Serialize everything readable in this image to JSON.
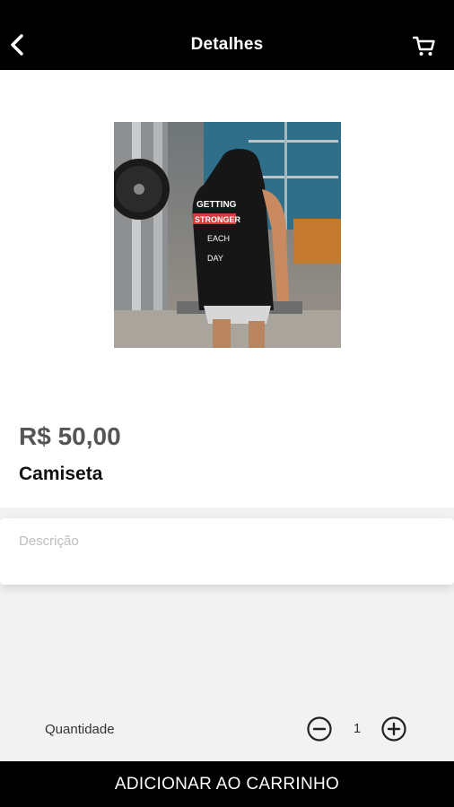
{
  "header": {
    "title": "Detalhes",
    "back_icon": "chevron-left-icon",
    "cart_icon": "cart-icon"
  },
  "product": {
    "price": "R$ 50,00",
    "name": "Camiseta",
    "image_shirt_text": [
      "GETTING",
      "STRONGER",
      "EACH",
      "DAY"
    ]
  },
  "description": {
    "placeholder": "Descrição"
  },
  "quantity": {
    "label": "Quantidade",
    "value": "1",
    "decrease_icon": "minus-circle-icon",
    "increase_icon": "plus-circle-icon"
  },
  "add_button": {
    "label": "ADICIONAR AO CARRINHO"
  }
}
